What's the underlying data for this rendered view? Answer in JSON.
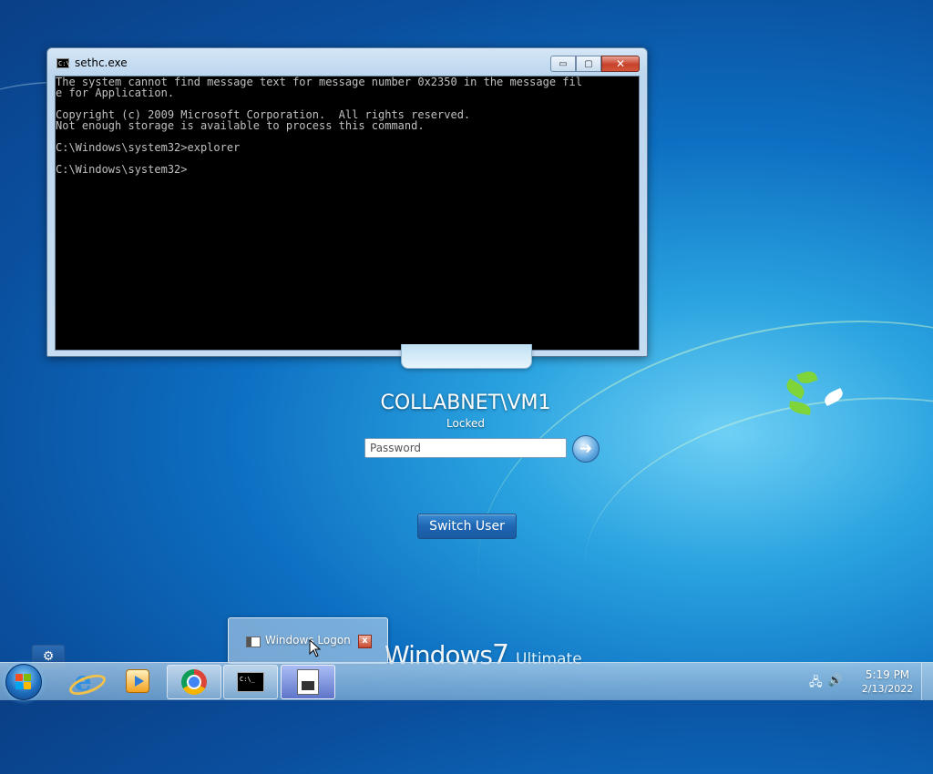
{
  "console_window": {
    "title": "sethc.exe",
    "minimize_label": "▭",
    "maximize_label": "▢",
    "close_label": "✕",
    "lines": [
      "The system cannot find message text for message number 0x2350 in the message fil",
      "e for Application.",
      "",
      "Copyright (c) 2009 Microsoft Corporation.  All rights reserved.",
      "Not enough storage is available to process this command.",
      "",
      "C:\\Windows\\system32>explorer",
      "",
      "C:\\Windows\\system32>"
    ]
  },
  "logon": {
    "user_name": "COLLABNET\\VM1",
    "status": "Locked",
    "password_placeholder": "Password",
    "switch_user_label": "Switch User",
    "go_arrow": "➜"
  },
  "branding": {
    "windows": "Windows",
    "version": "7",
    "edition": "Ultimate"
  },
  "thumbnail": {
    "title": "Windows Logon",
    "close_label": "x"
  },
  "taskbar": {
    "cmd_icon_text": "C:\\_",
    "clock_time": "5:19 PM",
    "clock_date": "2/13/2022"
  }
}
